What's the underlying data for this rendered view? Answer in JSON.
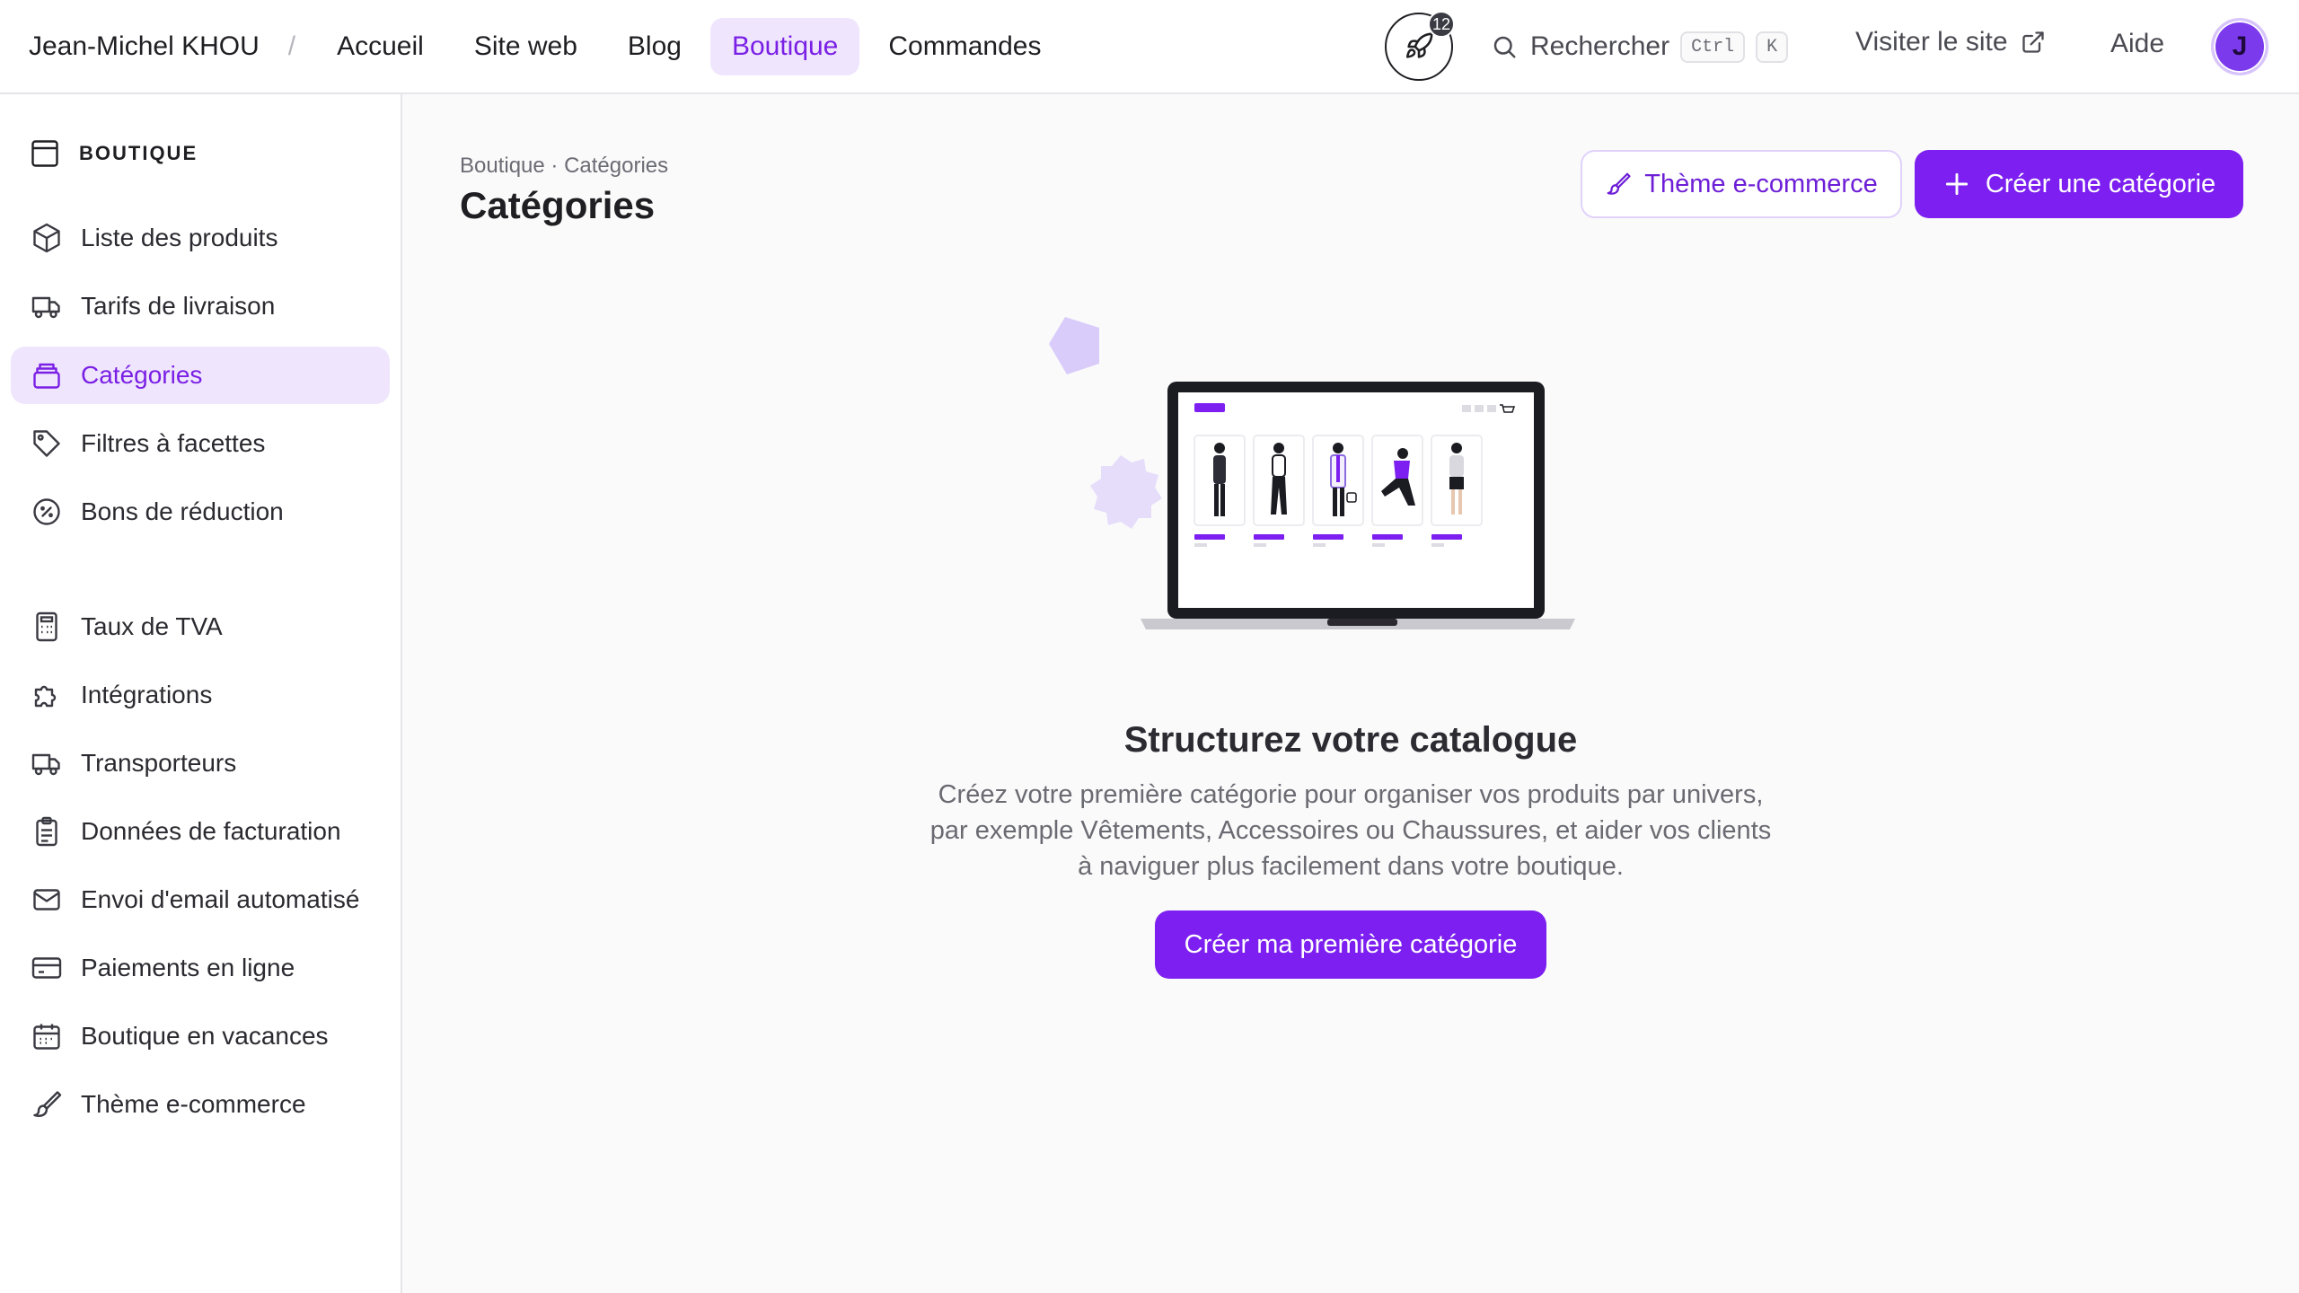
{
  "topbar": {
    "owner": "Jean-Michel KHOU",
    "separator": "/",
    "nav": [
      "Accueil",
      "Site web",
      "Blog",
      "Boutique",
      "Commandes"
    ],
    "active_nav": "Boutique",
    "notification_count": "12",
    "search_label": "Rechercher",
    "shortcut_keys": [
      "Ctrl",
      "K"
    ],
    "visit_label": "Visiter le site",
    "help_label": "Aide",
    "avatar_initial": "J"
  },
  "sidebar": {
    "header": "BOUTIQUE",
    "items": [
      {
        "label": "Liste des produits",
        "icon": "box-icon"
      },
      {
        "label": "Tarifs de livraison",
        "icon": "truck-icon"
      },
      {
        "label": "Catégories",
        "icon": "folder-stack-icon",
        "active": true
      },
      {
        "label": "Filtres à facettes",
        "icon": "tag-icon"
      },
      {
        "label": "Bons de réduction",
        "icon": "percent-badge-icon"
      },
      {
        "label": "Taux de TVA",
        "icon": "calculator-icon"
      },
      {
        "label": "Intégrations",
        "icon": "puzzle-icon"
      },
      {
        "label": "Transporteurs",
        "icon": "truck-icon"
      },
      {
        "label": "Données de facturation",
        "icon": "clipboard-icon"
      },
      {
        "label": "Envoi d'email automatisé",
        "icon": "mail-icon"
      },
      {
        "label": "Paiements en ligne",
        "icon": "credit-card-icon"
      },
      {
        "label": "Boutique en vacances",
        "icon": "calendar-icon"
      },
      {
        "label": "Thème e-commerce",
        "icon": "brush-icon"
      }
    ]
  },
  "main": {
    "breadcrumb": "Boutique · Catégories",
    "title": "Catégories",
    "theme_button": "Thème e-commerce",
    "create_button": "Créer une catégorie",
    "empty_title": "Structurez votre catalogue",
    "empty_description": "Créez votre première catégorie pour organiser vos produits par univers, par exemple Vêtements, Accessoires ou Chaussures, et aider vos clients à naviguer plus facilement dans votre boutique.",
    "empty_cta": "Créer ma première catégorie"
  },
  "colors": {
    "accent": "#7c1ff0",
    "accent_soft": "#efe6fd",
    "decor": "#d9ccfa"
  }
}
